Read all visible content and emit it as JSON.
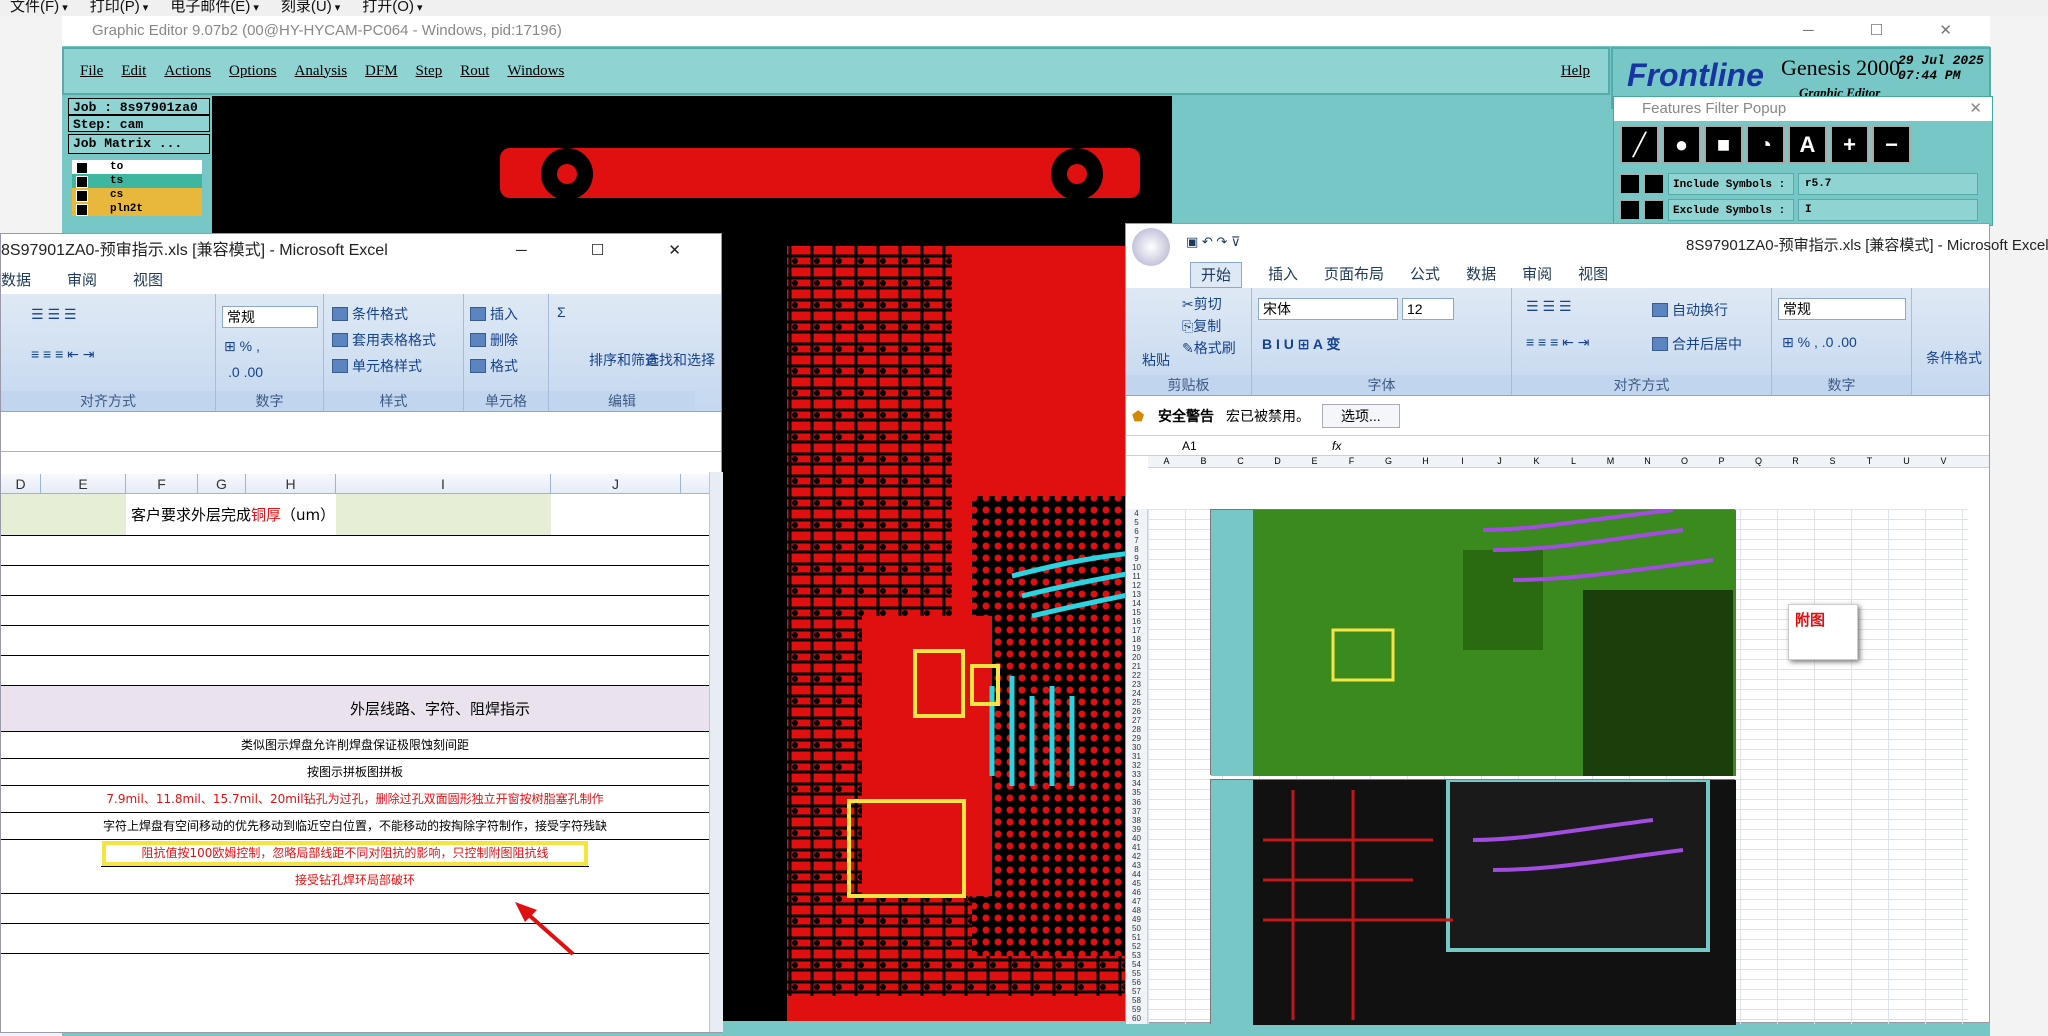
{
  "top_menu": [
    "文件(F)",
    "打印(P)",
    "电子邮件(E)",
    "刻录(U)",
    "打开(O)"
  ],
  "genesis": {
    "window_title": "Graphic Editor 9.07b2 (00@HY-HYCAM-PC064 - Windows, pid:17196)",
    "window_controls": "─ ☐ ✕",
    "menu": [
      "File",
      "Edit",
      "Actions",
      "Options",
      "Analysis",
      "DFM",
      "Step",
      "Rout",
      "Windows"
    ],
    "help": "Help",
    "logo_brand": "Frontline",
    "logo_product": "Genesis 2000",
    "logo_sub": "Graphic Editor",
    "date": "29 Jul 2025",
    "time": "07:44 PM",
    "job": "Job : 8s97901za0",
    "step": "Step: cam",
    "job_matrix": "Job Matrix ...",
    "layers": [
      {
        "name": "to",
        "color": "#ffffff"
      },
      {
        "name": "ts",
        "color": "#3fb6a0"
      },
      {
        "name": "cs",
        "color": "#e8b83c"
      },
      {
        "name": "pln2t",
        "color": "#e8b83c"
      }
    ]
  },
  "features_filter": {
    "title": "Features Filter Popup",
    "close": "✕",
    "buttons": [
      "╱",
      "●",
      "■",
      "◔",
      "A",
      "+",
      "−"
    ],
    "include_label": "Include Symbols :",
    "include_value": "r5.7",
    "exclude_label": "Exclude Symbols :",
    "exclude_value": "I"
  },
  "excel_left": {
    "title": "8S97901ZA0-预审指示.xls [兼容模式] - Microsoft Excel",
    "window_controls": "─ ☐ ✕",
    "tabs": [
      "数据",
      "审阅",
      "视图"
    ],
    "number_format": "常规",
    "styles": [
      "条件格式",
      "套用表格格式",
      "单元格样式"
    ],
    "cells_btns": [
      "插入",
      "删除",
      "格式"
    ],
    "edit_btns": [
      "排序和筛选",
      "查找和选择"
    ],
    "groups": [
      "对齐方式",
      "数字",
      "样式",
      "单元格",
      "编辑"
    ],
    "columns": [
      "D",
      "E",
      "F",
      "G",
      "H",
      "I",
      "J"
    ],
    "header_cell_prefix": "客户要求外层完成",
    "header_cell_red": "铜厚",
    "header_cell_suffix": "（um）",
    "section_title": "外层线路、字符、阻焊指示",
    "rows": [
      {
        "text": "类似图示焊盘允许削焊盘保证极限蚀刻间距",
        "red": false
      },
      {
        "text": "按图示拼板图拼板",
        "red": false
      },
      {
        "text": "7.9mil、11.8mil、15.7mil、20mil钻孔为过孔，删除过孔双面圆形独立开窗按树脂塞孔制作",
        "red": true
      },
      {
        "text": "字符上焊盘有空间移动的优先移动到临近空白位置，不能移动的按掏除字符制作，接受字符残缺",
        "red": false
      },
      {
        "text": "阻抗值按100欧姆控制，忽略局部线距不同对阻抗的影响，只控制附图阻抗线",
        "red": true
      },
      {
        "text": "接受钻孔焊环局部破环",
        "red": true
      }
    ]
  },
  "excel_right": {
    "title": "8S97901ZA0-预审指示.xls [兼容模式] - Microsoft Excel",
    "tabs": [
      "开始",
      "插入",
      "页面布局",
      "公式",
      "数据",
      "审阅",
      "视图"
    ],
    "clipboard": [
      "粘贴",
      "剪切",
      "复制",
      "格式刷"
    ],
    "font_name": "宋体",
    "font_size": "12",
    "wrap": "自动换行",
    "merge": "合并后居中",
    "number_format": "常规",
    "cond_format": "条件格式",
    "groups": [
      "剪贴板",
      "字体",
      "对齐方式",
      "数字"
    ],
    "security_label": "安全警告",
    "security_text": "宏已被禁用。",
    "options_btn": "选项...",
    "name_box": "A1",
    "fx": "fx",
    "columns": [
      "A",
      "B",
      "C",
      "D",
      "E",
      "F",
      "G",
      "H",
      "I",
      "J",
      "K",
      "L",
      "M",
      "N",
      "O",
      "P",
      "Q",
      "R",
      "S",
      "T",
      "U",
      "V"
    ],
    "row_start": 4,
    "row_end": 60,
    "attached_label": "附图"
  }
}
